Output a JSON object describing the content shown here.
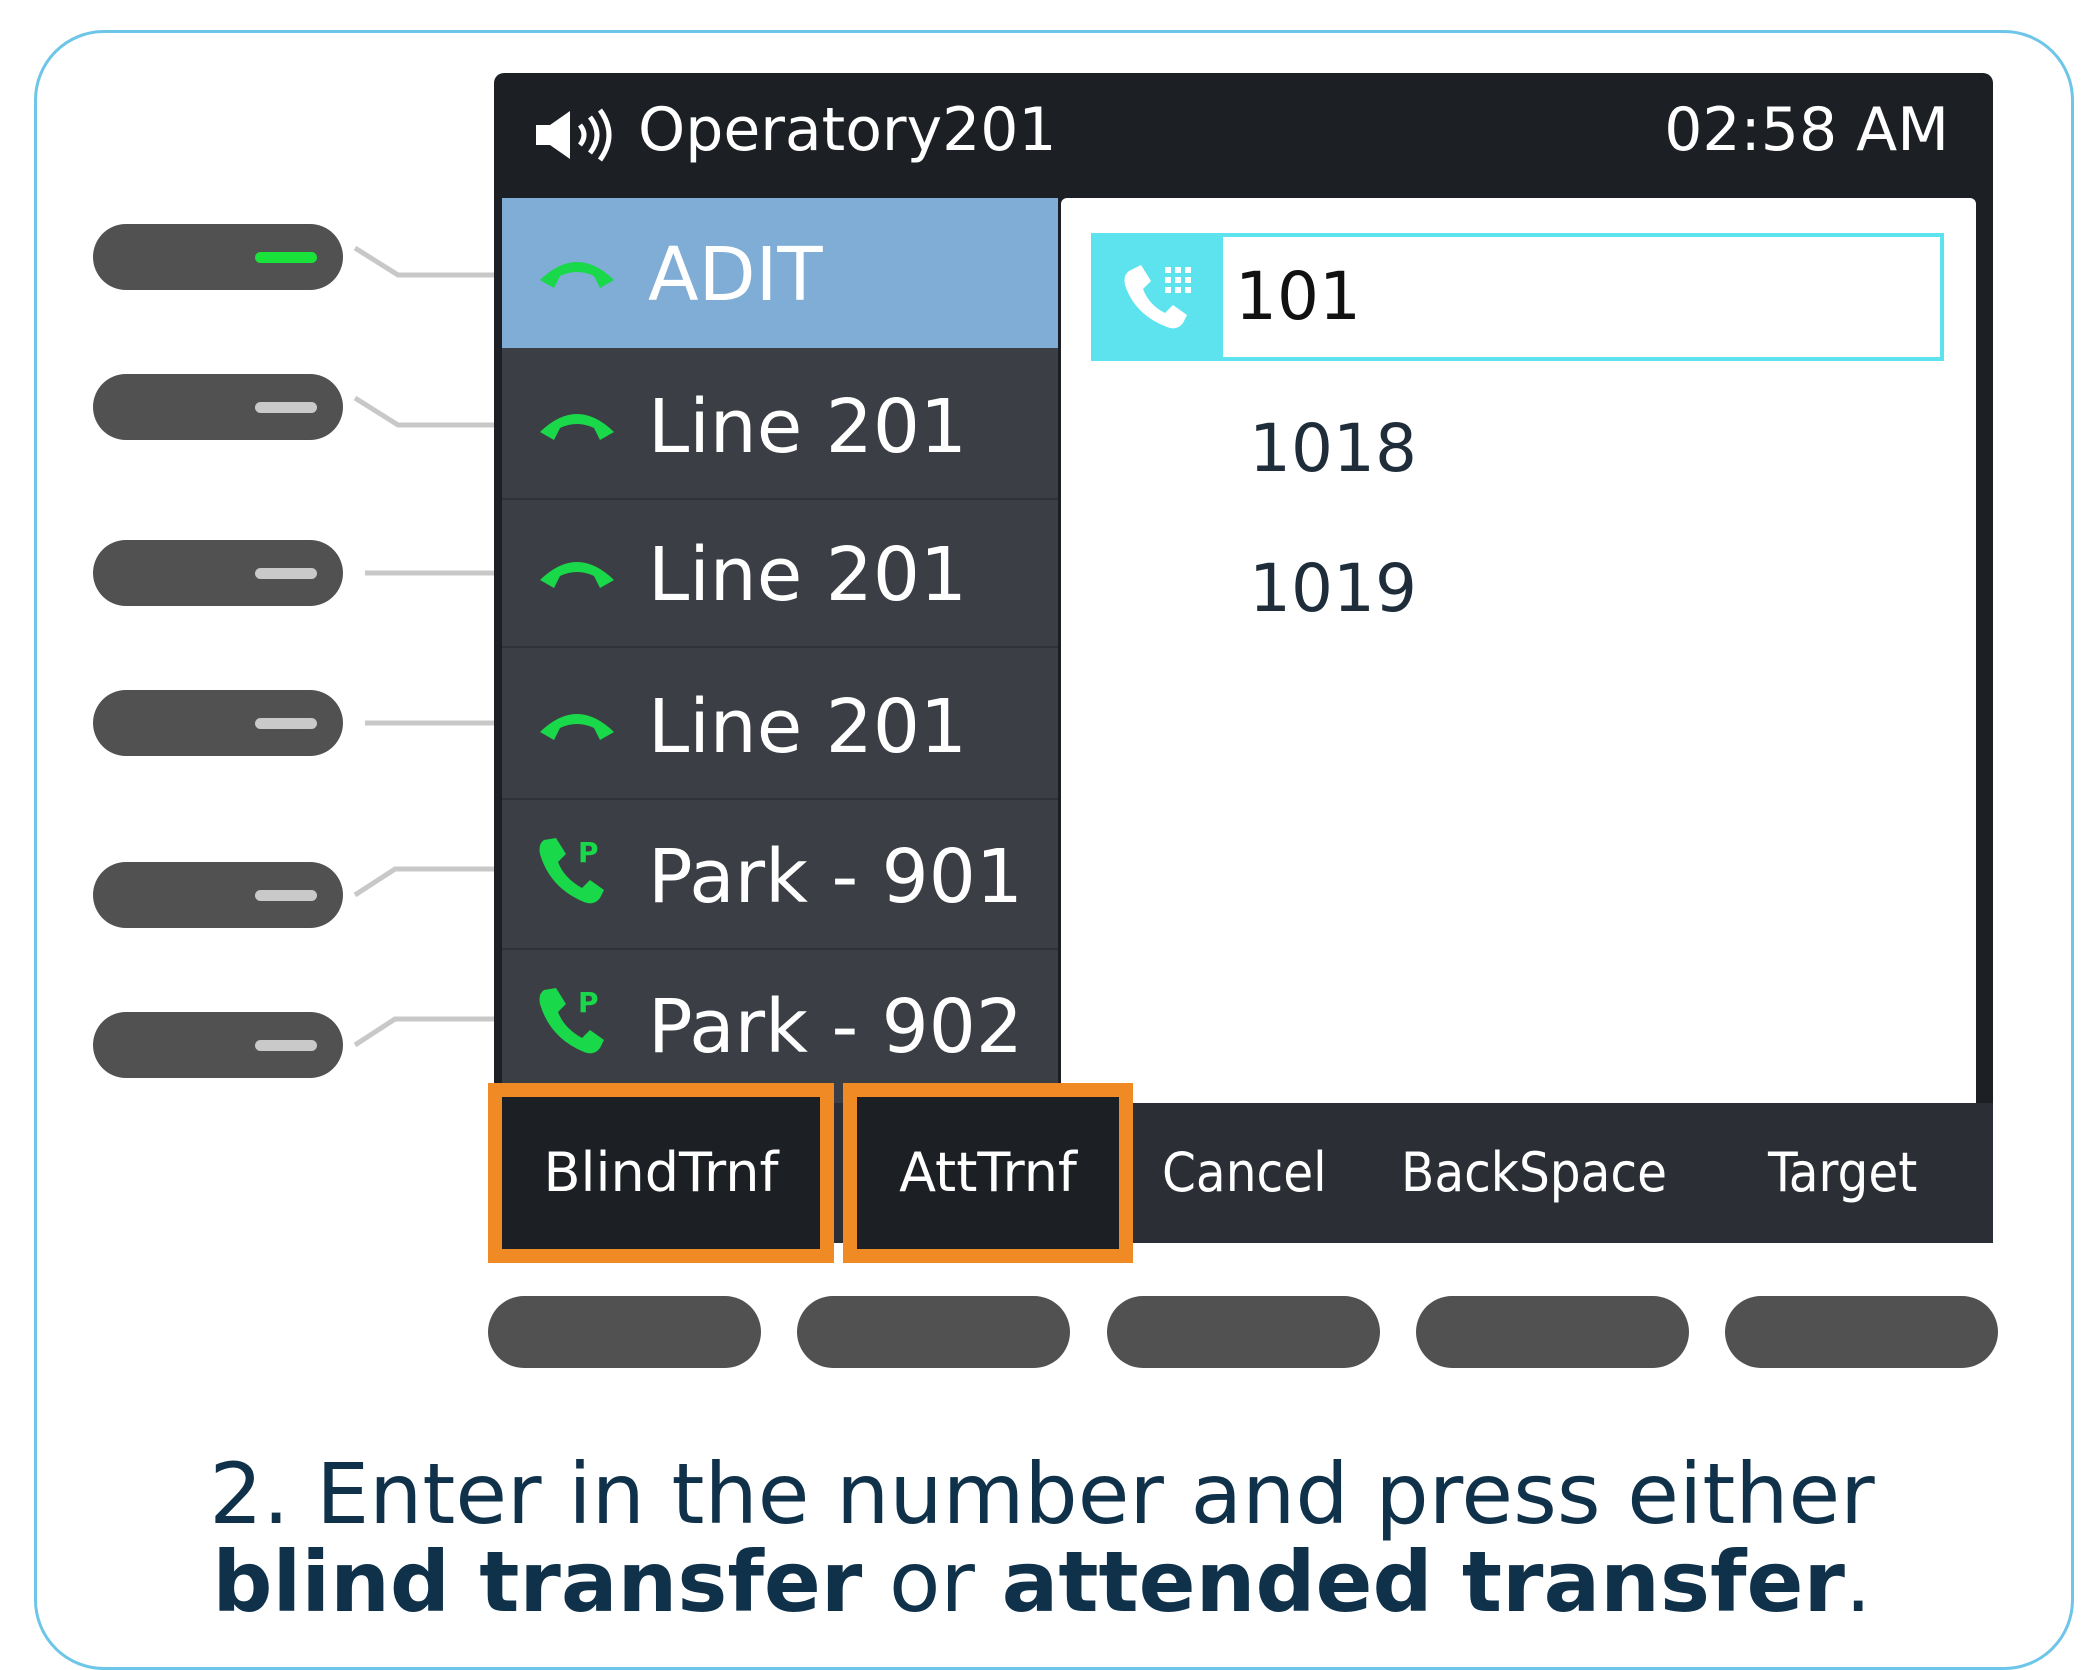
{
  "status": {
    "title": "Operatory201",
    "time": "02:58 AM"
  },
  "lines": [
    {
      "label": "ADIT",
      "icon": "handset-icon",
      "selected": true
    },
    {
      "label": "Line 201",
      "icon": "handset-icon"
    },
    {
      "label": "Line 201",
      "icon": "handset-icon"
    },
    {
      "label": "Line 201",
      "icon": "handset-icon"
    },
    {
      "label": "Park - 901",
      "icon": "park-icon"
    },
    {
      "label": "Park - 902",
      "icon": "park-icon"
    }
  ],
  "dial": {
    "value": "101",
    "suggestions": [
      "1018",
      "1019"
    ]
  },
  "softkeys": {
    "blind": "BlindTrnf",
    "att": "AttTrnf",
    "cancel": "Cancel",
    "backspace": "BackSpace",
    "target": "Target"
  },
  "caption": {
    "line1": "2. Enter in the number and press either",
    "bold1": "blind transfer",
    "mid": " or ",
    "bold2": "attended transfer",
    "end": "."
  },
  "colors": {
    "highlight": "#f08a24",
    "led_active": "#19e33a",
    "selected_line": "#7fadd6",
    "input_accent": "#5de3ee"
  }
}
